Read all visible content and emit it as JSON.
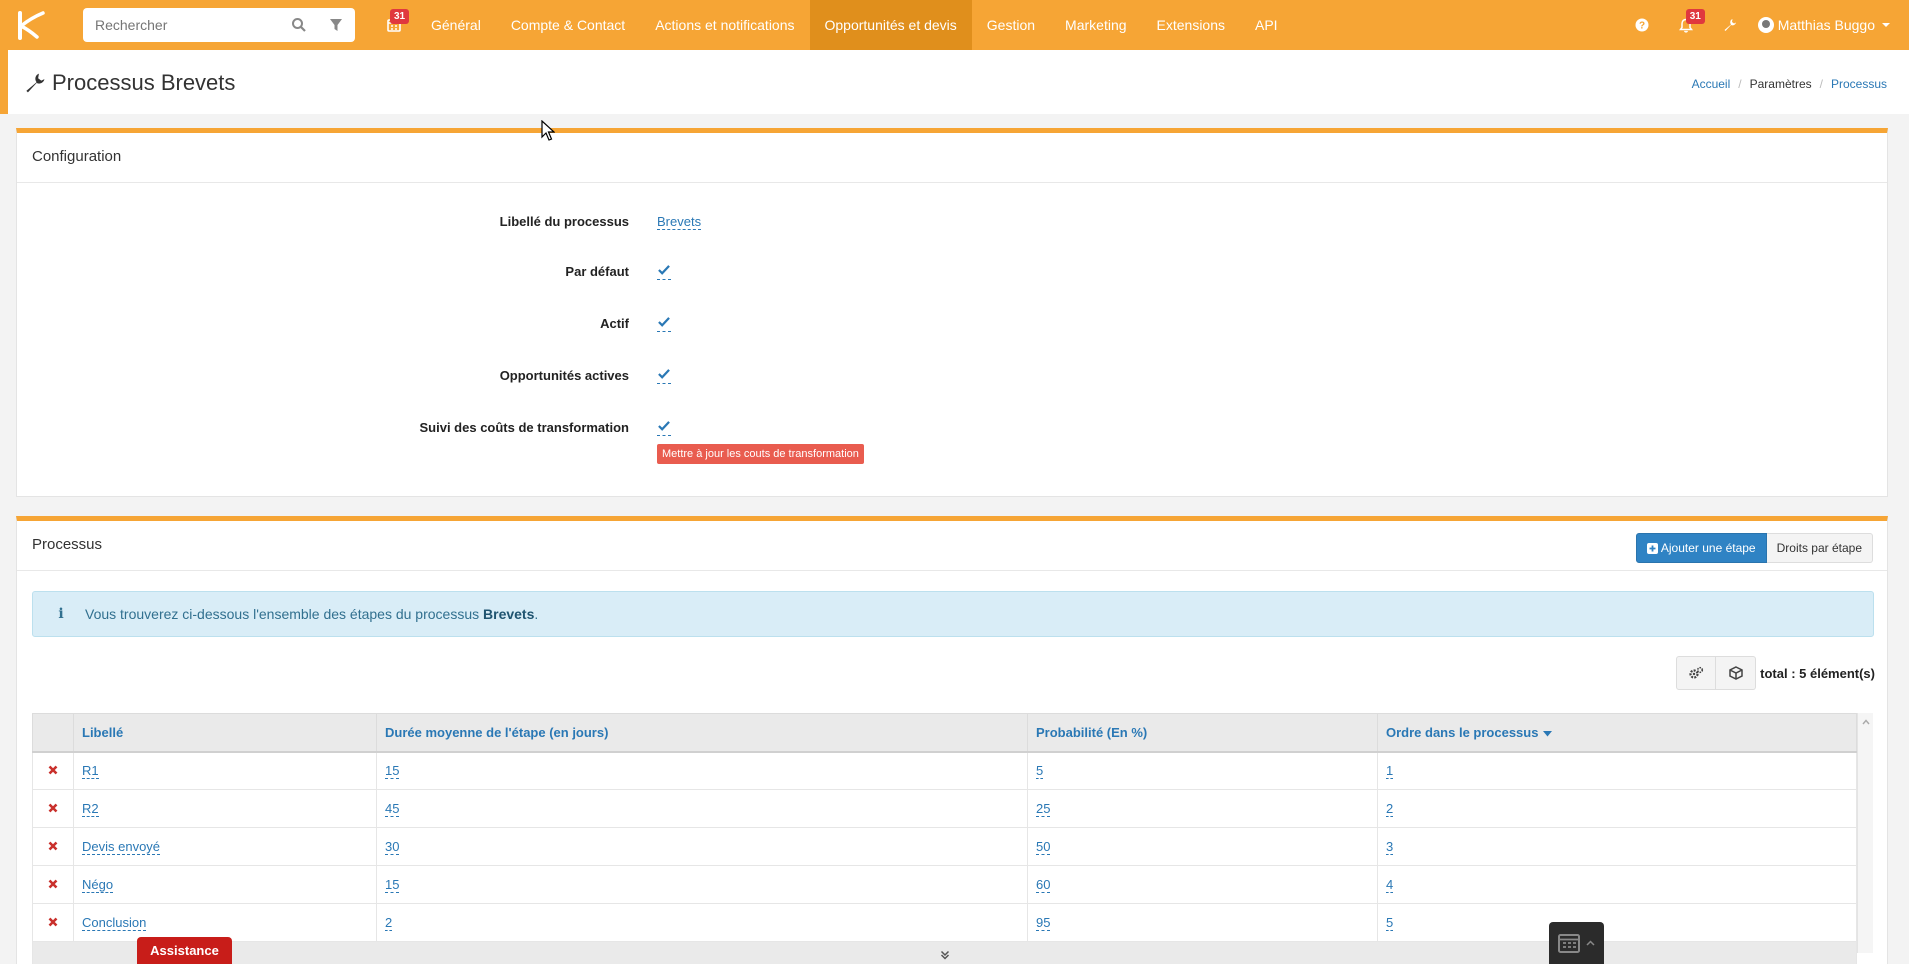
{
  "colors": {
    "brand": "#f6a535",
    "link": "#2a78b5",
    "danger": "#c9302c"
  },
  "topbar": {
    "search_placeholder": "Rechercher",
    "calendar_badge": "31",
    "nav": [
      "Général",
      "Compte & Contact",
      "Actions et notifications",
      "Opportunités et devis",
      "Gestion",
      "Marketing",
      "Extensions",
      "API"
    ],
    "active_nav": "Opportunités et devis",
    "notif_badge": "31",
    "user_name": "Matthias Buggo"
  },
  "page": {
    "title": "Processus Brevets",
    "breadcrumb": {
      "home": "Accueil",
      "settings": "Paramètres",
      "current": "Processus"
    }
  },
  "config": {
    "title": "Configuration",
    "process_label": "Libellé du processus",
    "process_value": "Brevets",
    "default_label": "Par défaut",
    "active_label": "Actif",
    "opportunities_label": "Opportunités actives",
    "costs_label": "Suivi des coûts de transformation",
    "update_costs_button": "Mettre à jour les couts de transformation"
  },
  "process": {
    "title": "Processus",
    "add_step_button": "Ajouter une étape",
    "rights_button": "Droits par étape",
    "info_text": "Vous trouverez ci-dessous l'ensemble des étapes du processus ",
    "info_bold": "Brevets",
    "info_end": ".",
    "total": "total : 5 élément(s)",
    "columns": {
      "label": "Libellé",
      "duration": "Durée moyenne de l'étape (en jours)",
      "probability": "Probabilité (En %)",
      "order": "Ordre dans le processus"
    },
    "rows": [
      {
        "label": "R1",
        "duration": "15",
        "probability": "5",
        "order": "1"
      },
      {
        "label": "R2",
        "duration": "45",
        "probability": "25",
        "order": "2"
      },
      {
        "label": "Devis envoyé",
        "duration": "30",
        "probability": "50",
        "order": "3"
      },
      {
        "label": "Négo",
        "duration": "15",
        "probability": "60",
        "order": "4"
      },
      {
        "label": "Conclusion",
        "duration": "2",
        "probability": "95",
        "order": "5"
      }
    ]
  },
  "assistance": "Assistance"
}
